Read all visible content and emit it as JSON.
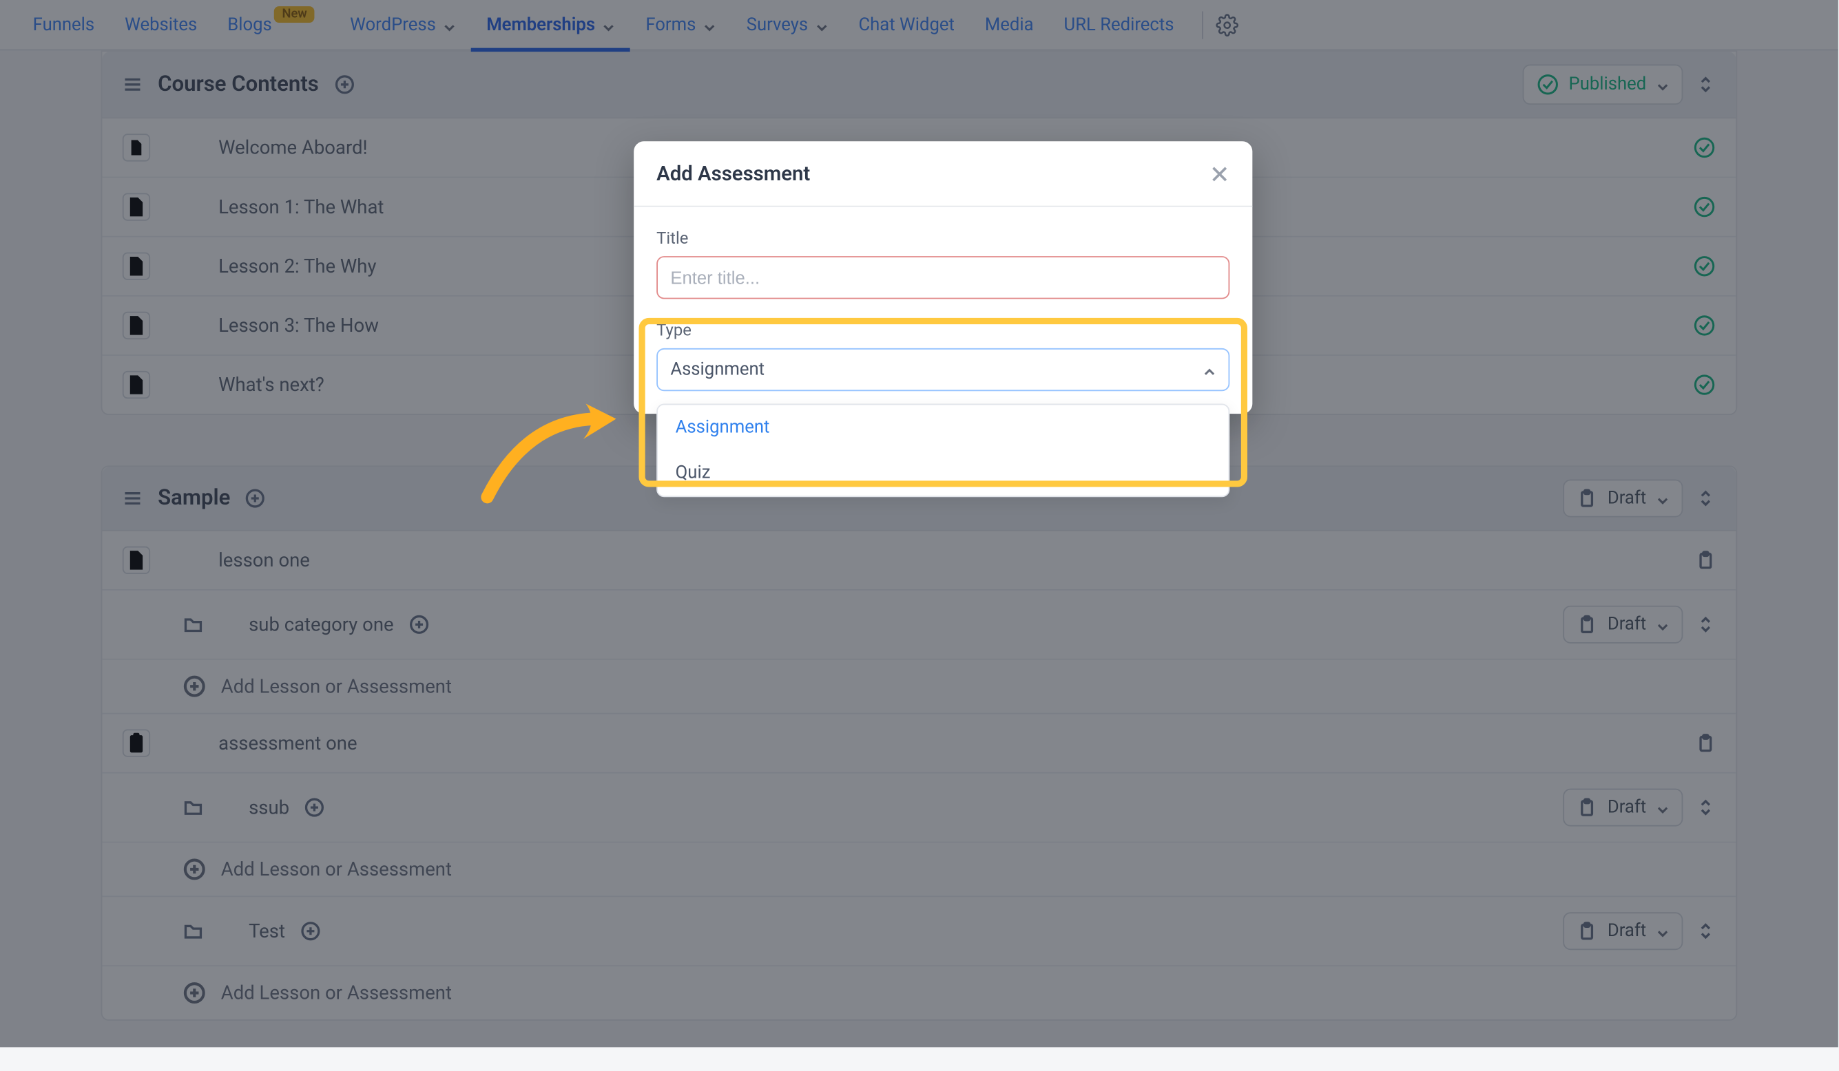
{
  "nav": {
    "items": [
      {
        "label": "Funnels",
        "dropdown": false
      },
      {
        "label": "Websites",
        "dropdown": false
      },
      {
        "label": "Blogs",
        "dropdown": false,
        "badge": "New"
      },
      {
        "label": "WordPress",
        "dropdown": true
      },
      {
        "label": "Memberships",
        "dropdown": true,
        "active": true
      },
      {
        "label": "Forms",
        "dropdown": true
      },
      {
        "label": "Surveys",
        "dropdown": true
      },
      {
        "label": "Chat Widget",
        "dropdown": false
      },
      {
        "label": "Media",
        "dropdown": false
      },
      {
        "label": "URL Redirects",
        "dropdown": false
      }
    ]
  },
  "sections": [
    {
      "title": "Course Contents",
      "status": "Published",
      "status_green": true,
      "rows": [
        {
          "type": "lesson",
          "label": "Welcome Aboard!",
          "checked": true
        },
        {
          "type": "lesson",
          "label": "Lesson 1: The What",
          "checked": true
        },
        {
          "type": "lesson",
          "label": "Lesson 2: The Why",
          "checked": true
        },
        {
          "type": "lesson",
          "label": "Lesson 3: The How",
          "checked": true
        },
        {
          "type": "lesson",
          "label": "What's next?",
          "checked": true
        }
      ]
    },
    {
      "title": "Sample",
      "status": "Draft",
      "status_green": false,
      "rows": [
        {
          "type": "lesson",
          "label": "lesson one",
          "clip": true
        },
        {
          "type": "subcat",
          "label": "sub category one",
          "status": "Draft"
        },
        {
          "type": "add",
          "label": "Add Lesson or Assessment"
        },
        {
          "type": "assessment",
          "label": "assessment one",
          "clip": true
        },
        {
          "type": "subcat",
          "label": "ssub",
          "status": "Draft"
        },
        {
          "type": "add",
          "label": "Add Lesson or Assessment"
        },
        {
          "type": "subcat",
          "label": "Test",
          "status": "Draft"
        },
        {
          "type": "add",
          "label": "Add Lesson or Assessment"
        }
      ]
    }
  ],
  "modal": {
    "title": "Add Assessment",
    "fields": {
      "title_label": "Title",
      "title_placeholder": "Enter title...",
      "type_label": "Type",
      "type_value": "Assignment"
    },
    "options": [
      {
        "label": "Assignment",
        "active": true
      },
      {
        "label": "Quiz",
        "active": false
      }
    ]
  }
}
